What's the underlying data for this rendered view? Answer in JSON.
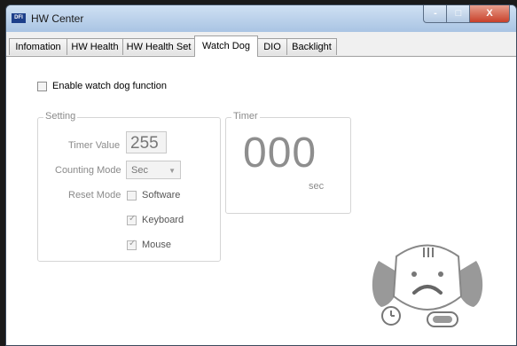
{
  "window": {
    "title": "HW Center",
    "app_icon_text": "DFI"
  },
  "controls": {
    "minimize": "-",
    "maximize": "□",
    "close": "X"
  },
  "tabs": [
    "Infomation",
    "HW Health",
    "HW Health Set",
    "Watch Dog",
    "DIO",
    "Backlight"
  ],
  "active_tab": "Watch Dog",
  "enable": {
    "label": "Enable watch dog function",
    "checked": false
  },
  "setting": {
    "title": "Setting",
    "timer_value_label": "Timer Value",
    "timer_value": "255",
    "counting_mode_label": "Counting Mode",
    "counting_mode": "Sec",
    "reset_mode_label": "Reset Mode",
    "options": [
      {
        "label": "Software",
        "checked": false
      },
      {
        "label": "Keyboard",
        "checked": true
      },
      {
        "label": "Mouse",
        "checked": true
      }
    ]
  },
  "timer": {
    "title": "Timer",
    "value": "000",
    "unit": "sec"
  },
  "icons": {
    "mascot": "watchdog-mascot-icon",
    "dropdown": "chevron-down-icon"
  },
  "colors": {
    "titlebar": "#b9d1ea",
    "close_button": "#c8402a",
    "disabled_text": "#8a8a8a"
  }
}
